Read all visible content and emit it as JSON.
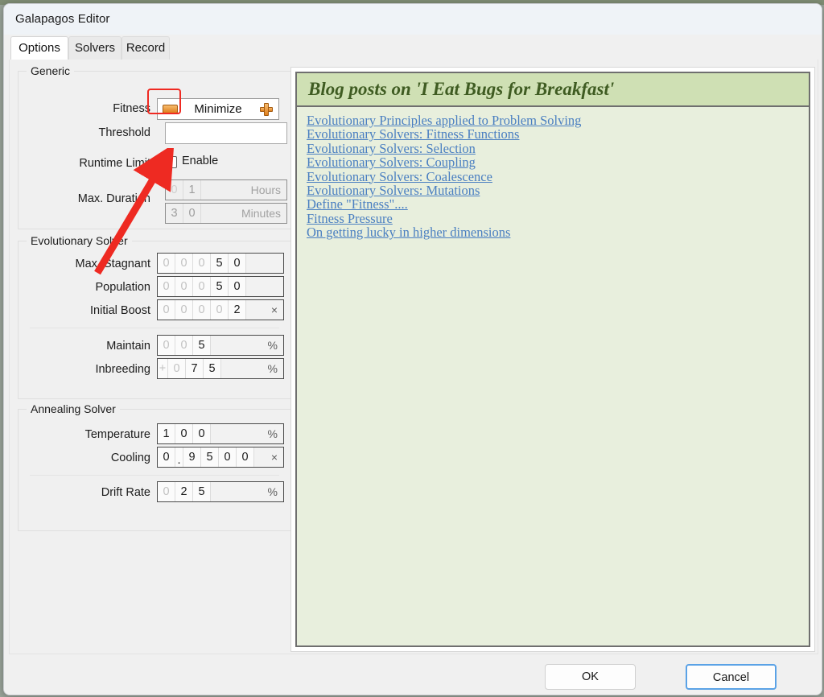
{
  "window": {
    "title": "Galapagos Editor"
  },
  "tabs": [
    {
      "label": "Options",
      "active": true
    },
    {
      "label": "Solvers",
      "active": false
    },
    {
      "label": "Record",
      "active": false
    }
  ],
  "groups": {
    "generic": {
      "legend": "Generic"
    },
    "evolutionary": {
      "legend": "Evolutionary Solver"
    },
    "annealing": {
      "legend": "Annealing Solver"
    }
  },
  "generic": {
    "fitness": {
      "label": "Fitness",
      "value": "Minimize",
      "minus_icon": "minus-icon",
      "plus_icon": "plus-icon",
      "highlighted": true
    },
    "threshold": {
      "label": "Threshold",
      "value": ""
    },
    "runtime_limit": {
      "label": "Runtime Limit",
      "checkbox_label": "Enable",
      "checked": false
    },
    "max_duration": {
      "label": "Max. Duration",
      "hours": {
        "digits": [
          "0",
          "1"
        ],
        "dim": [
          true,
          false
        ],
        "unit": "Hours",
        "disabled": true
      },
      "minutes": {
        "digits": [
          "3",
          "0"
        ],
        "dim": [
          false,
          false
        ],
        "unit": "Minutes",
        "disabled": true
      }
    }
  },
  "evolutionary": {
    "max_stagnant": {
      "label": "Max. Stagnant",
      "digits": [
        "0",
        "0",
        "0",
        "5",
        "0"
      ],
      "dim": [
        true,
        true,
        true,
        false,
        false
      ],
      "unit": ""
    },
    "population": {
      "label": "Population",
      "digits": [
        "0",
        "0",
        "0",
        "5",
        "0"
      ],
      "dim": [
        true,
        true,
        true,
        false,
        false
      ],
      "unit": ""
    },
    "initial_boost": {
      "label": "Initial Boost",
      "digits": [
        "0",
        "0",
        "0",
        "0",
        "2"
      ],
      "dim": [
        true,
        true,
        true,
        true,
        false
      ],
      "unit": "×"
    },
    "maintain": {
      "label": "Maintain",
      "digits": [
        "0",
        "0",
        "5"
      ],
      "dim": [
        true,
        true,
        false
      ],
      "unit": "%"
    },
    "inbreeding": {
      "label": "Inbreeding",
      "sign": "+",
      "sign_dim": true,
      "digits": [
        "0",
        "7",
        "5"
      ],
      "dim": [
        true,
        false,
        false
      ],
      "unit": "%"
    }
  },
  "annealing": {
    "temperature": {
      "label": "Temperature",
      "digits": [
        "1",
        "0",
        "0"
      ],
      "dim": [
        false,
        false,
        false
      ],
      "unit": "%"
    },
    "cooling": {
      "label": "Cooling",
      "digits": [
        "0",
        ".",
        "9",
        "5",
        "0",
        "0"
      ],
      "dim": [
        false,
        false,
        false,
        false,
        false,
        false
      ],
      "unit": "×"
    },
    "drift_rate": {
      "label": "Drift Rate",
      "digits": [
        "0",
        "2",
        "5"
      ],
      "dim": [
        true,
        false,
        false
      ],
      "unit": "%"
    }
  },
  "blog": {
    "title": "Blog posts on 'I Eat Bugs for Breakfast'",
    "links": [
      "Evolutionary Principles applied to Problem Solving",
      "Evolutionary Solvers: Fitness Functions",
      "Evolutionary Solvers: Selection",
      "Evolutionary Solvers: Coupling",
      "Evolutionary Solvers: Coalescence",
      "Evolutionary Solvers: Mutations",
      "Define \"Fitness\"....",
      "Fitness Pressure",
      "On getting lucky in higher dimensions"
    ]
  },
  "footer": {
    "ok": "OK",
    "cancel": "Cancel"
  },
  "annotation": {
    "type": "arrow",
    "color": "#ee2a22",
    "points_to": "fitness-minus-button"
  },
  "colors": {
    "accent_orange": "#df7e1c",
    "annotation_red": "#ee2a22",
    "blog_header_green": "#cfe0b4",
    "blog_body_green": "#e8efdd",
    "link_blue": "#4a7fc1",
    "focus_blue": "#5aa2e6"
  }
}
